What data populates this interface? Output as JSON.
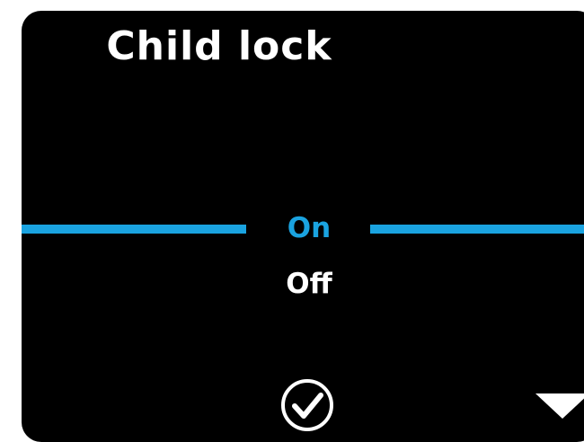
{
  "screen": {
    "title": "Child lock"
  },
  "options": [
    {
      "label": "On",
      "selected": true
    },
    {
      "label": "Off",
      "selected": false
    }
  ],
  "icons": {
    "confirm": "checkmark-circle-icon",
    "scroll": "triangle-down-icon"
  },
  "colors": {
    "background": "#000000",
    "text": "#ffffff",
    "accent": "#1aa3e0"
  }
}
